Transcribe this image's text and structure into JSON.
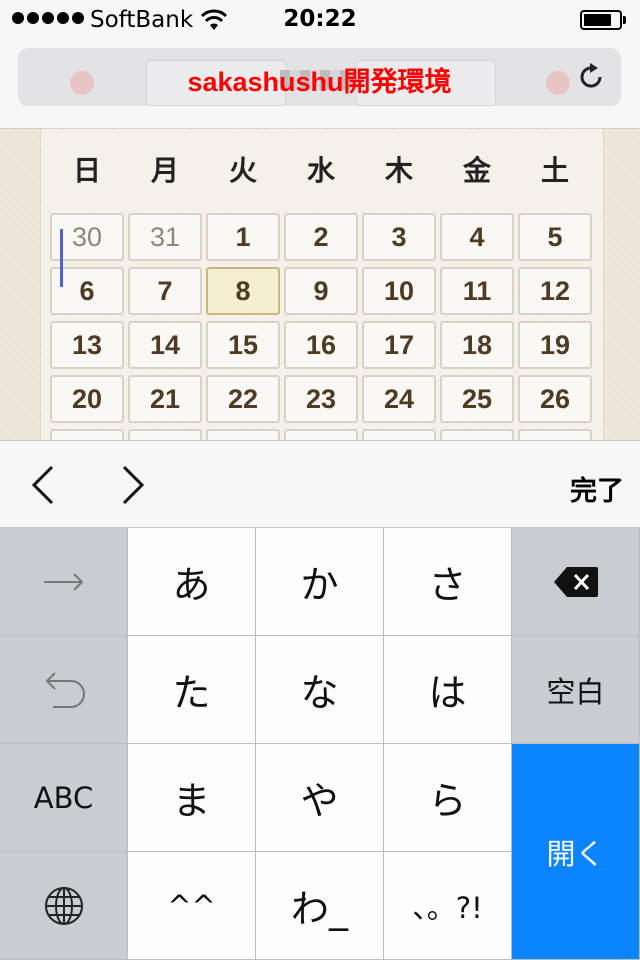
{
  "status_bar": {
    "carrier": "SoftBank",
    "time": "20:22",
    "signal_bars": 5,
    "battery_level": 0.8
  },
  "address_bar": {
    "title": "sakashushu開発環境"
  },
  "calendar": {
    "weekdays": [
      "日",
      "月",
      "火",
      "水",
      "木",
      "金",
      "土"
    ],
    "weeks": [
      [
        {
          "d": "30",
          "prev": true
        },
        {
          "d": "31",
          "prev": true
        },
        {
          "d": "1"
        },
        {
          "d": "2"
        },
        {
          "d": "3"
        },
        {
          "d": "4"
        },
        {
          "d": "5"
        }
      ],
      [
        {
          "d": "6"
        },
        {
          "d": "7"
        },
        {
          "d": "8",
          "today": true
        },
        {
          "d": "9"
        },
        {
          "d": "10"
        },
        {
          "d": "11"
        },
        {
          "d": "12"
        }
      ],
      [
        {
          "d": "13"
        },
        {
          "d": "14"
        },
        {
          "d": "15"
        },
        {
          "d": "16"
        },
        {
          "d": "17"
        },
        {
          "d": "18"
        },
        {
          "d": "19"
        }
      ],
      [
        {
          "d": "20"
        },
        {
          "d": "21"
        },
        {
          "d": "22"
        },
        {
          "d": "23"
        },
        {
          "d": "24"
        },
        {
          "d": "25"
        },
        {
          "d": "26"
        }
      ]
    ]
  },
  "accessory_bar": {
    "done_label": "完了"
  },
  "keyboard": {
    "left_column": {
      "next_candidate_icon": "arrow-right-icon",
      "undo_icon": "undo-icon",
      "abc_label": "ABC",
      "globe_icon": "globe-icon"
    },
    "keys": [
      [
        "あ",
        "か",
        "さ"
      ],
      [
        "た",
        "な",
        "は"
      ],
      [
        "ま",
        "や",
        "ら"
      ],
      [
        "^^",
        "わ_",
        "、。?!"
      ]
    ],
    "right_column": {
      "delete_icon": "delete-icon",
      "space_label": "空白",
      "open_label": "開く"
    }
  }
}
